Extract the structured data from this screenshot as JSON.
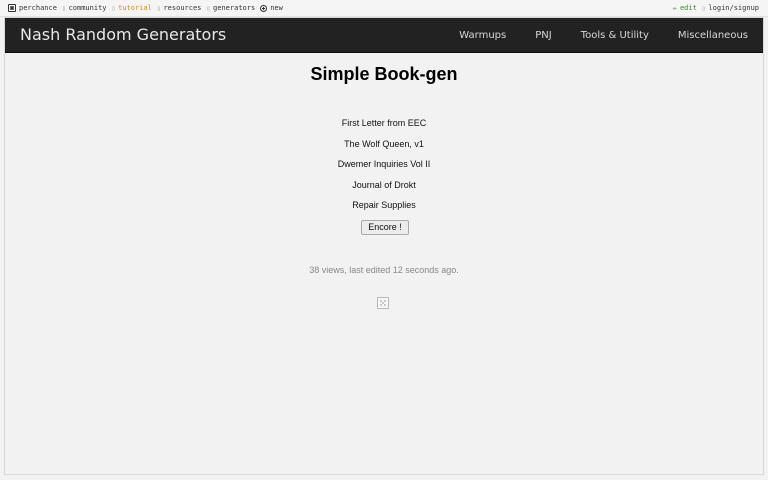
{
  "topbar": {
    "left": [
      {
        "label": "perchance",
        "icon": "die-icon"
      },
      {
        "label": "community",
        "icon": "community-icon"
      },
      {
        "label": "tutorial",
        "icon": "tutorial-icon"
      },
      {
        "label": "resources",
        "icon": "resources-icon"
      },
      {
        "label": "generators",
        "icon": "generators-icon"
      },
      {
        "label": "new",
        "icon": "plus-circle-icon"
      }
    ],
    "right": [
      {
        "label": "edit",
        "icon": "pencil-icon"
      },
      {
        "label": "login/signup",
        "icon": "user-icon"
      }
    ],
    "colors": {
      "tutorial": "#d98a1a",
      "edit": "#3a8a2a"
    }
  },
  "navbar": {
    "brand": "Nash Random Generators",
    "links": [
      "Warmups",
      "PNJ",
      "Tools & Utility",
      "Miscellaneous"
    ]
  },
  "main": {
    "title": "Simple Book-gen",
    "outputs": [
      "First Letter from EEC",
      "The Wolf Queen, v1",
      "Dwemer Inquiries Vol II",
      "Journal of Drokt",
      "Repair Supplies"
    ],
    "button_label": "Encore !",
    "views_text": "38 views, last edited 12 seconds ago."
  }
}
